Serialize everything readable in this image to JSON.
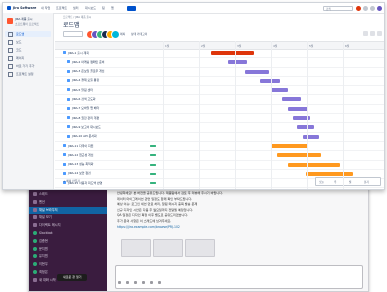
{
  "slack": {
    "sidebar_items": [
      {
        "label": "스레드",
        "active": false
      },
      {
        "label": "멘션",
        "active": false
      },
      {
        "label": "채널 브라우저",
        "active": true
      },
      {
        "label": "채널 보기",
        "active": false
      },
      {
        "label": "다이렉트 메시지",
        "active": false
      },
      {
        "label": "Slackbot",
        "active": false
      },
      {
        "label": "김종현",
        "active": false
      },
      {
        "label": "문지원",
        "active": false
      },
      {
        "label": "유지원",
        "active": false
      },
      {
        "label": "이현우",
        "active": false
      },
      {
        "label": "최정은",
        "active": false
      },
      {
        "label": "새 대화 시작",
        "active": false
      }
    ],
    "tooltip": "새로운 창 열기",
    "messages": [
      "안녕하세요! 본 버전을 공유드립니다. 제품팀에서 검토 후 리뷰해 주시기 바랍니다.",
      "데이터 마이그레이션 관련 일정도 함께 확인 부탁드립니다.",
      "예상 이슈: 로그인 세션 만료 처리, 알림 메시지 중복 발송 문제",
      "신규 디자인 시안은 다음 주 월요일까지 전달될 예정입니다.",
      "QA 일정은 디자인 확정 이후 별도로 공유드리겠습니다.",
      "추가 문의 사항은 이 스레드에 남겨주세요.",
      "https://jira.example.com/browse/PRJ-102"
    ]
  },
  "jira": {
    "app_title": "Jira Software",
    "nav": [
      "내 작업",
      "프로젝트",
      "필터",
      "대시보드",
      "팀",
      "앱"
    ],
    "search_placeholder": "검색",
    "project_name": "JIRA 제품 출시",
    "project_type": "소프트웨어 프로젝트",
    "sidebar_items": [
      {
        "label": "로드맵",
        "active": true
      },
      {
        "label": "보드",
        "active": false
      },
      {
        "label": "코드",
        "active": false
      },
      {
        "label": "페이지",
        "active": false
      },
      {
        "label": "바로 가기 추가",
        "active": false
      },
      {
        "label": "프로젝트 설정",
        "active": false
      }
    ],
    "breadcrumb": "프로젝트 / JIRA 제품 출시",
    "page_title": "로드맵",
    "filter_label": "에픽",
    "filter_status": "상태 카테고리",
    "months": [
      "1월",
      "2월",
      "3월",
      "4월",
      "5월",
      "6월"
    ],
    "footer": "+ 에픽 만들기",
    "zoom": [
      "오늘",
      "주",
      "월",
      "분기"
    ],
    "rows": [
      {
        "label": "JIRA-1 출시 계획",
        "child": false,
        "status": false,
        "bar_start": 0.22,
        "bar_end": 0.42,
        "color": "#de350b"
      },
      {
        "label": "JIRA-2 마케팅 캠페인 준비",
        "child": true,
        "status": false,
        "bar_start": 0.3,
        "bar_end": 0.39,
        "color": "#8777d9"
      },
      {
        "label": "JIRA-3 온보딩 플로우 개선",
        "child": true,
        "status": false,
        "bar_start": 0.38,
        "bar_end": 0.49,
        "color": "#8777d9"
      },
      {
        "label": "JIRA-4 결제 모듈 통합",
        "child": true,
        "status": false,
        "bar_start": 0.45,
        "bar_end": 0.54,
        "color": "#8777d9"
      },
      {
        "label": "JIRA-5 알림 센터",
        "child": true,
        "status": false,
        "bar_start": 0.5,
        "bar_end": 0.58,
        "color": "#8777d9"
      },
      {
        "label": "JIRA-6 검색 고도화",
        "child": true,
        "status": false,
        "bar_start": 0.55,
        "bar_end": 0.64,
        "color": "#8777d9"
      },
      {
        "label": "JIRA-7 모바일 앱 베타",
        "child": true,
        "status": false,
        "bar_start": 0.58,
        "bar_end": 0.67,
        "color": "#8777d9"
      },
      {
        "label": "JIRA-8 권한 관리 개편",
        "child": true,
        "status": false,
        "bar_start": 0.6,
        "bar_end": 0.68,
        "color": "#8777d9"
      },
      {
        "label": "JIRA-9 보고서 대시보드",
        "child": true,
        "status": false,
        "bar_start": 0.62,
        "bar_end": 0.7,
        "color": "#8777d9"
      },
      {
        "label": "JIRA-10 API 문서화",
        "child": true,
        "status": false,
        "bar_start": 0.65,
        "bar_end": 0.72,
        "color": "#8777d9"
      },
      {
        "label": "JIRA-11 다국어 지원",
        "child": false,
        "status": true,
        "bar_start": 0.5,
        "bar_end": 0.67,
        "color": "#ff991f"
      },
      {
        "label": "JIRA-12 접근성 개선",
        "child": false,
        "status": true,
        "bar_start": 0.53,
        "bar_end": 0.73,
        "color": "#ff991f"
      },
      {
        "label": "JIRA-13 성능 최적화",
        "child": false,
        "status": true,
        "bar_start": 0.58,
        "bar_end": 0.82,
        "color": "#ff991f"
      },
      {
        "label": "JIRA-14 보안 점검",
        "child": false,
        "status": true,
        "bar_start": 0.66,
        "bar_end": 0.88,
        "color": "#ff991f"
      },
      {
        "label": "JIRA-15 사용자 피드백 반영",
        "child": false,
        "status": true,
        "bar_start": 0.72,
        "bar_end": 0.92,
        "color": "#ff991f"
      },
      {
        "label": "JIRA-16 출시 후 모니터링",
        "child": false,
        "status": true,
        "bar_start": 0.8,
        "bar_end": 0.98,
        "color": "#ff991f"
      }
    ]
  },
  "colors": {
    "slack_sidebar": "#3a1c3f",
    "jira_blue": "#0052cc",
    "epic_red": "#de350b",
    "epic_purple": "#8777d9",
    "epic_orange": "#ff991f",
    "status_green": "#36b37e"
  }
}
